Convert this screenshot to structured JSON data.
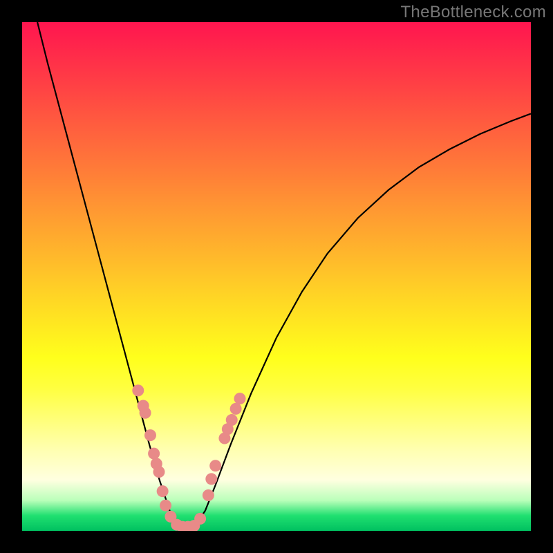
{
  "watermark": "TheBottleneck.com",
  "chart_data": {
    "type": "line",
    "title": "",
    "xlabel": "",
    "ylabel": "",
    "xlim": [
      0,
      100
    ],
    "ylim": [
      0,
      100
    ],
    "grid": false,
    "legend": false,
    "series": [
      {
        "name": "curve-left",
        "x": [
          3,
          5,
          7,
          9,
          11,
          13,
          15,
          17,
          19,
          21,
          23,
          25,
          27,
          29,
          30,
          31,
          32
        ],
        "y": [
          100,
          92,
          84.5,
          77,
          69.5,
          62,
          54.5,
          47,
          39.5,
          32,
          24.5,
          17,
          10,
          4,
          1.5,
          0.5,
          0.2
        ]
      },
      {
        "name": "curve-right",
        "x": [
          32,
          34,
          36,
          38,
          41,
          45,
          50,
          55,
          60,
          66,
          72,
          78,
          84,
          90,
          96,
          100
        ],
        "y": [
          0.2,
          1,
          4,
          9,
          17,
          27,
          38,
          47,
          54.5,
          61.5,
          67,
          71.5,
          75,
          78,
          80.5,
          82
        ]
      }
    ],
    "scatter": {
      "name": "dots",
      "color": "#e88a88",
      "points": [
        {
          "x": 22.8,
          "y": 27.6
        },
        {
          "x": 23.8,
          "y": 24.6
        },
        {
          "x": 24.2,
          "y": 23.2
        },
        {
          "x": 25.2,
          "y": 18.8
        },
        {
          "x": 25.9,
          "y": 15.2
        },
        {
          "x": 26.4,
          "y": 13.2
        },
        {
          "x": 26.9,
          "y": 11.6
        },
        {
          "x": 27.6,
          "y": 7.8
        },
        {
          "x": 28.2,
          "y": 5.0
        },
        {
          "x": 29.2,
          "y": 2.8
        },
        {
          "x": 30.4,
          "y": 1.2
        },
        {
          "x": 31.5,
          "y": 0.8
        },
        {
          "x": 32.6,
          "y": 0.8
        },
        {
          "x": 33.8,
          "y": 1.0
        },
        {
          "x": 35.0,
          "y": 2.4
        },
        {
          "x": 36.6,
          "y": 7.0
        },
        {
          "x": 37.2,
          "y": 10.2
        },
        {
          "x": 38.0,
          "y": 12.8
        },
        {
          "x": 39.8,
          "y": 18.2
        },
        {
          "x": 40.4,
          "y": 20.0
        },
        {
          "x": 41.2,
          "y": 21.8
        },
        {
          "x": 42.0,
          "y": 24.0
        },
        {
          "x": 42.8,
          "y": 26.0
        }
      ]
    },
    "gradient_background": {
      "top_color": "#ff154f",
      "bottom_color": "#00c060",
      "description": "vertical red-to-green heat gradient"
    }
  }
}
